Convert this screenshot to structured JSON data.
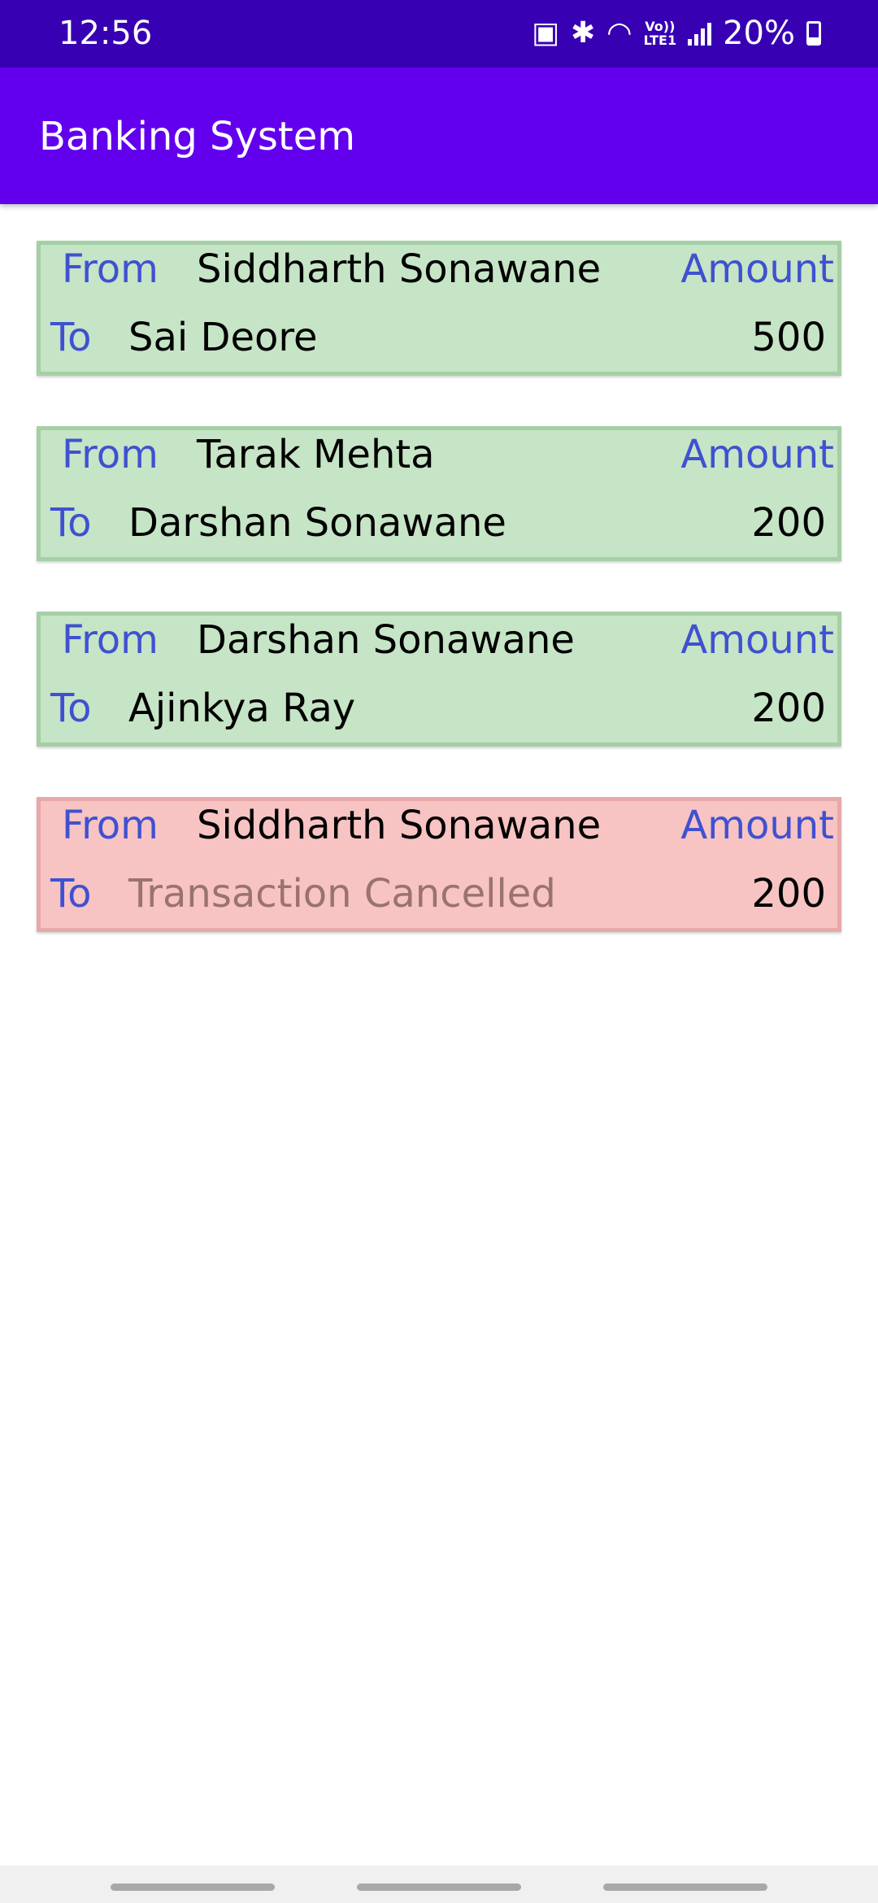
{
  "status_bar": {
    "time": "12:56",
    "battery_percent": "20%",
    "volte_label": "Vo)) LTE1",
    "icons": [
      "sim-icon",
      "bluetooth-icon",
      "wifi-icon",
      "volte-icon",
      "signal-icon",
      "battery-icon"
    ]
  },
  "app_bar": {
    "title": "Banking System",
    "background_color": "#6200ee"
  },
  "labels": {
    "from": "From",
    "to": "To",
    "amount": "Amount"
  },
  "transactions": [
    {
      "from": "Siddharth Sonawane",
      "to": "Sai Deore",
      "amount": "500",
      "status": "success"
    },
    {
      "from": "Tarak Mehta",
      "to": "Darshan Sonawane",
      "amount": "200",
      "status": "success"
    },
    {
      "from": "Darshan Sonawane",
      "to": "Ajinkya Ray",
      "amount": "200",
      "status": "success"
    },
    {
      "from": "Siddharth Sonawane",
      "to": "Transaction Cancelled",
      "amount": "200",
      "status": "cancelled"
    }
  ],
  "colors": {
    "success_card": "#c6e4c6",
    "cancelled_card": "#f7c3c3",
    "label_blue": "#3f51d1",
    "status_bar": "#3700b3"
  }
}
